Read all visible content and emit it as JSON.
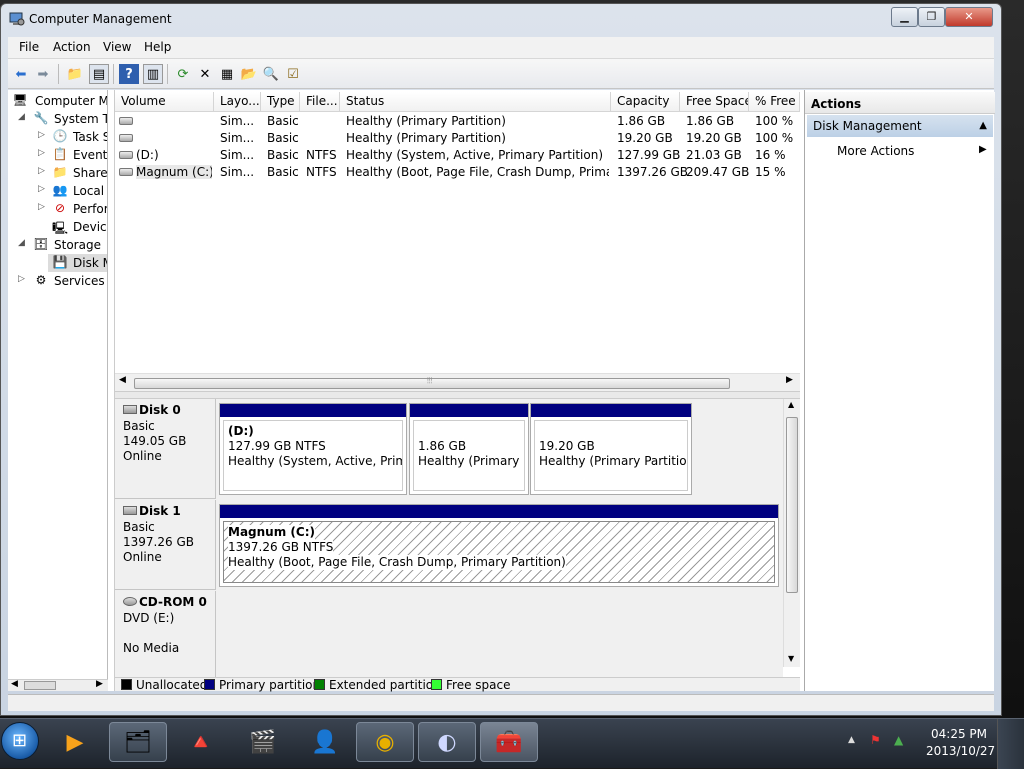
{
  "window": {
    "title": "Computer Management",
    "minimize": "▁",
    "maximize": "❐",
    "close": "✕"
  },
  "menu": [
    "File",
    "Action",
    "View",
    "Help"
  ],
  "tree": {
    "items": [
      {
        "label": "Computer Ma",
        "icon": "computer-management-icon",
        "glyph": "🖥",
        "arrow": ""
      },
      {
        "label": "System To",
        "icon": "system-tools-icon",
        "glyph": "🔧",
        "arrow": "◢"
      },
      {
        "label": "Task S",
        "icon": "task-scheduler-icon",
        "glyph": "🕒",
        "arrow": "▷"
      },
      {
        "label": "Event V",
        "icon": "event-viewer-icon",
        "glyph": "📋",
        "arrow": "▷"
      },
      {
        "label": "Shared",
        "icon": "shared-folders-icon",
        "glyph": "📁",
        "arrow": "▷"
      },
      {
        "label": "Local U",
        "icon": "local-users-icon",
        "glyph": "👥",
        "arrow": "▷"
      },
      {
        "label": "Perforn",
        "icon": "performance-icon",
        "glyph": "⊘",
        "arrow": "▷"
      },
      {
        "label": "Device",
        "icon": "device-manager-icon",
        "glyph": "🖳",
        "arrow": ""
      },
      {
        "label": "Storage",
        "icon": "storage-icon",
        "glyph": "🗄",
        "arrow": "◢"
      },
      {
        "label": "Disk M",
        "icon": "disk-management-icon",
        "glyph": "💾",
        "arrow": ""
      },
      {
        "label": "Services ar",
        "icon": "services-icon",
        "glyph": "⚙",
        "arrow": "▷"
      }
    ]
  },
  "volumes": {
    "headers": [
      "Volume",
      "Layo...",
      "Type",
      "File...",
      "Status",
      "Capacity",
      "Free Space",
      "% Free"
    ],
    "rows": [
      {
        "volume": "",
        "layout": "Sim...",
        "type": "Basic",
        "fs": "",
        "status": "Healthy (Primary Partition)",
        "capacity": "1.86 GB",
        "free": "1.86 GB",
        "pct": "100 %"
      },
      {
        "volume": "",
        "layout": "Sim...",
        "type": "Basic",
        "fs": "",
        "status": "Healthy (Primary Partition)",
        "capacity": "19.20 GB",
        "free": "19.20 GB",
        "pct": "100 %"
      },
      {
        "volume": "(D:)",
        "layout": "Sim...",
        "type": "Basic",
        "fs": "NTFS",
        "status": "Healthy (System, Active, Primary Partition)",
        "capacity": "127.99 GB",
        "free": "21.03 GB",
        "pct": "16 %"
      },
      {
        "volume": "Magnum (C:)",
        "layout": "Sim...",
        "type": "Basic",
        "fs": "NTFS",
        "status": "Healthy (Boot, Page File, Crash Dump, Primary ...",
        "capacity": "1397.26 GB",
        "free": "209.47 GB",
        "pct": "15 %"
      }
    ],
    "hscroll_thumb": "⦙⦙⦙"
  },
  "disks": [
    {
      "name": "Disk 0",
      "type": "Basic",
      "size": "149.05 GB",
      "state": "Online",
      "partitions": [
        {
          "title": "(D:)",
          "size": "127.99 GB NTFS",
          "status": "Healthy (System, Active, Primary"
        },
        {
          "title": "",
          "size": "1.86 GB",
          "status": "Healthy (Primary Pa"
        },
        {
          "title": "",
          "size": "19.20 GB",
          "status": "Healthy (Primary Partition)"
        }
      ]
    },
    {
      "name": "Disk 1",
      "type": "Basic",
      "size": "1397.26 GB",
      "state": "Online",
      "partitions": [
        {
          "title": "Magnum  (C:)",
          "size": "1397.26 GB NTFS",
          "status": "Healthy (Boot, Page File, Crash Dump, Primary Partition)"
        }
      ]
    },
    {
      "name": "CD-ROM 0",
      "type": "DVD (E:)",
      "size": "",
      "state": "No Media"
    }
  ],
  "legend": [
    {
      "label": "Unallocated",
      "color": "#000000"
    },
    {
      "label": "Primary partition",
      "color": "#000080"
    },
    {
      "label": "Extended partition",
      "color": "#008000"
    },
    {
      "label": "Free space",
      "color": "#33ff33"
    }
  ],
  "actions": {
    "header": "Actions",
    "section": "Disk Management",
    "more": "More Actions"
  },
  "toolbar_icons": [
    "back-icon",
    "forward-icon",
    "up-folder-icon",
    "show-hide-tree-icon",
    "help-icon",
    "show-hide-action-pane-icon",
    "refresh-icon",
    "delete-icon",
    "properties-icon",
    "open-icon",
    "search-icon",
    "checklist-icon"
  ],
  "taskbar": {
    "items": [
      {
        "name": "media-player-icon",
        "glyph": "▶",
        "open": false
      },
      {
        "name": "file-explorer-icon",
        "glyph": "🗂",
        "open": true
      },
      {
        "name": "vlc-icon",
        "glyph": "🔺",
        "open": false
      },
      {
        "name": "video-editor-icon",
        "glyph": "🎬",
        "open": false
      },
      {
        "name": "contact-photo-icon",
        "glyph": "👤",
        "open": false
      },
      {
        "name": "chrome-icon",
        "glyph": "◉",
        "open": true
      },
      {
        "name": "bittorrent-icon",
        "glyph": "◐",
        "open": true
      },
      {
        "name": "toolbox-icon",
        "glyph": "🧰",
        "open": true
      }
    ],
    "time": "04:25 PM",
    "date": "2013/10/27"
  }
}
